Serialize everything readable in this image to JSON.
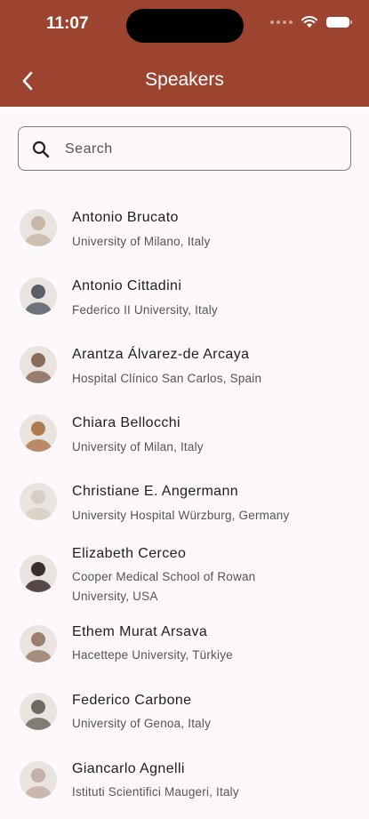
{
  "status": {
    "time": "11:07"
  },
  "header": {
    "title": "Speakers"
  },
  "search": {
    "placeholder": "Search",
    "value": ""
  },
  "speakers": [
    {
      "name": "Antonio Brucato",
      "affiliation": "University of Milano, Italy",
      "avatar_color": "#c9b8a8"
    },
    {
      "name": "Antonio Cittadini",
      "affiliation": "Federico II University, Italy",
      "avatar_color": "#5a5f6a"
    },
    {
      "name": "Arantza Álvarez-de Arcaya",
      "affiliation": "Hospital Clínico San Carlos, Spain",
      "avatar_color": "#8a6a5a"
    },
    {
      "name": "Chiara Bellocchi",
      "affiliation": "University of Milan, Italy",
      "avatar_color": "#b07a50"
    },
    {
      "name": "Christiane E. Angermann",
      "affiliation": "University Hospital Würzburg, Germany",
      "avatar_color": "#d8cfc4"
    },
    {
      "name": "Elizabeth Cerceo",
      "affiliation": "Cooper Medical School of Rowan University, USA",
      "avatar_color": "#3a2e2e"
    },
    {
      "name": "Ethem Murat Arsava",
      "affiliation": "Hacettepe University, Türkiye",
      "avatar_color": "#9a7f6d"
    },
    {
      "name": "Federico Carbone",
      "affiliation": "University of Genoa, Italy",
      "avatar_color": "#6e6a62"
    },
    {
      "name": "Giancarlo Agnelli",
      "affiliation": "Istituti Scientifici Maugeri, Italy",
      "avatar_color": "#c4b0a4"
    }
  ]
}
